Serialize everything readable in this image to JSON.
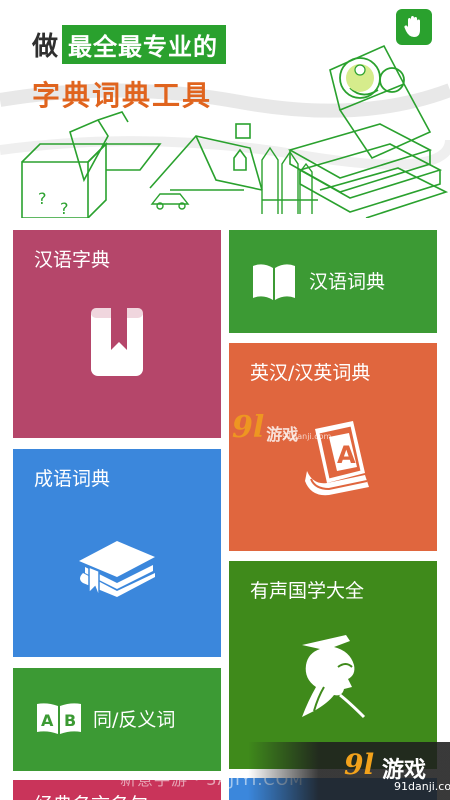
{
  "banner": {
    "lead": "做",
    "highlight": "最全最专业的",
    "subtitle": "字典词典工具",
    "hand_icon": "hand-raise-icon",
    "accent": "#2aa12e",
    "subtitle_color": "#e0641e"
  },
  "tiles": [
    {
      "label": "汉语字典",
      "icon": "bookmark-book-icon",
      "color": "#b5466a"
    },
    {
      "label": "汉语词典",
      "icon": "open-book-icon",
      "color": "#3c9a34"
    },
    {
      "label": "英汉/汉英词典",
      "icon": "english-book-a-icon",
      "color": "#e0663e"
    },
    {
      "label": "成语词典",
      "icon": "graduation-book-icon",
      "color": "#3b87dc"
    },
    {
      "label": "有声国学大全",
      "icon": "sage-portrait-icon",
      "color": "#3f8a1b"
    },
    {
      "label": "同/反义词",
      "icon": "ab-book-icon",
      "color": "#3c9a34"
    },
    {
      "label": "经典名言名句",
      "icon": "",
      "color": "#c9345a"
    }
  ],
  "watermarks": {
    "logo_number": "9l",
    "logo_text": "游戏",
    "logo_url": "91danji.com",
    "site_text": "新意手游 · 3AJIYI.COM"
  }
}
